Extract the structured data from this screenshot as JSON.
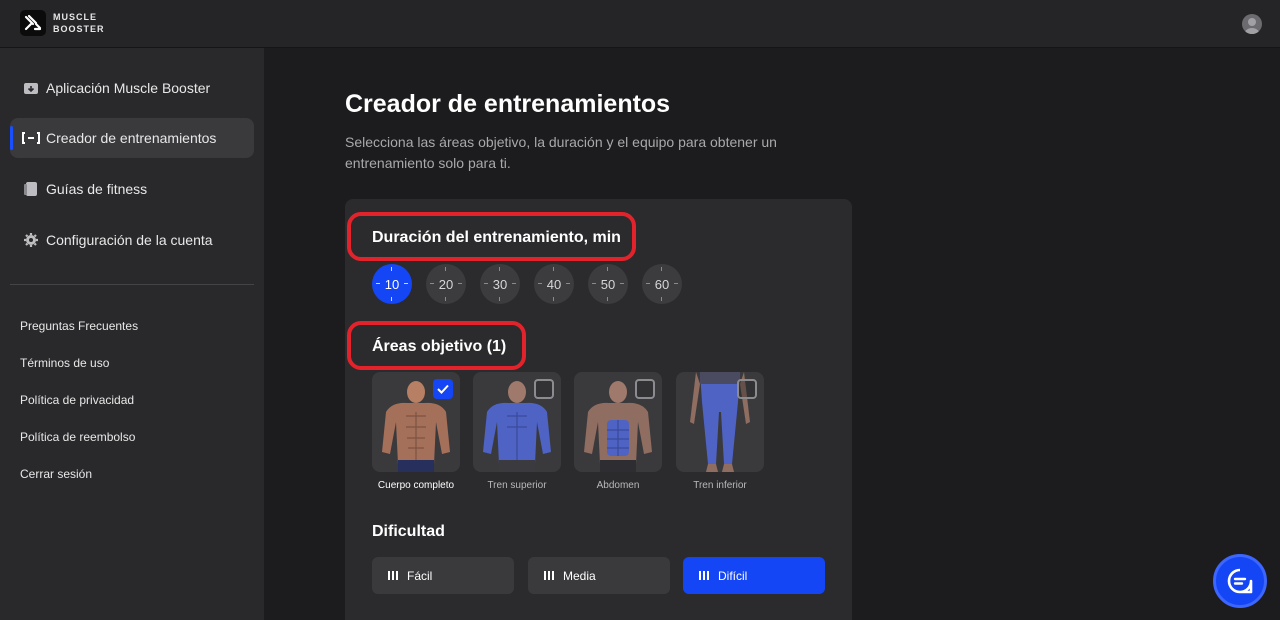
{
  "brand": {
    "line1": "MUSCLE",
    "line2": "BOOSTER"
  },
  "sidebar": {
    "nav": [
      {
        "label": "Aplicación Muscle Booster",
        "icon": "app-download-icon"
      },
      {
        "label": "Creador de entrenamientos",
        "icon": "dumbbell-icon"
      },
      {
        "label": "Guías de fitness",
        "icon": "guides-icon"
      },
      {
        "label": "Configuración de la cuenta",
        "icon": "gear-icon"
      }
    ],
    "links": [
      "Preguntas Frecuentes",
      "Términos de uso",
      "Política de privacidad",
      "Política de reembolso",
      "Cerrar sesión"
    ]
  },
  "main": {
    "title": "Creador de entrenamientos",
    "description": "Selecciona las áreas objetivo, la duración y el equipo para obtener un entrenamiento solo para ti.",
    "duration": {
      "title": "Duración del entrenamiento, min",
      "options": [
        "10",
        "20",
        "30",
        "40",
        "50",
        "60"
      ],
      "selected": "10"
    },
    "areas": {
      "title": "Áreas objetivo (1)",
      "items": [
        {
          "label": "Cuerpo completo",
          "checked": true
        },
        {
          "label": "Tren superior",
          "checked": false
        },
        {
          "label": "Abdomen",
          "checked": false
        },
        {
          "label": "Tren inferior",
          "checked": false
        }
      ]
    },
    "difficulty": {
      "title": "Dificultad",
      "options": [
        "Fácil",
        "Media",
        "Difícil"
      ],
      "selected": "Difícil"
    }
  },
  "colors": {
    "accent": "#1446f5",
    "highlight": "#e3232b",
    "background": "#1c1c1e",
    "sidebar": "#29292b"
  }
}
